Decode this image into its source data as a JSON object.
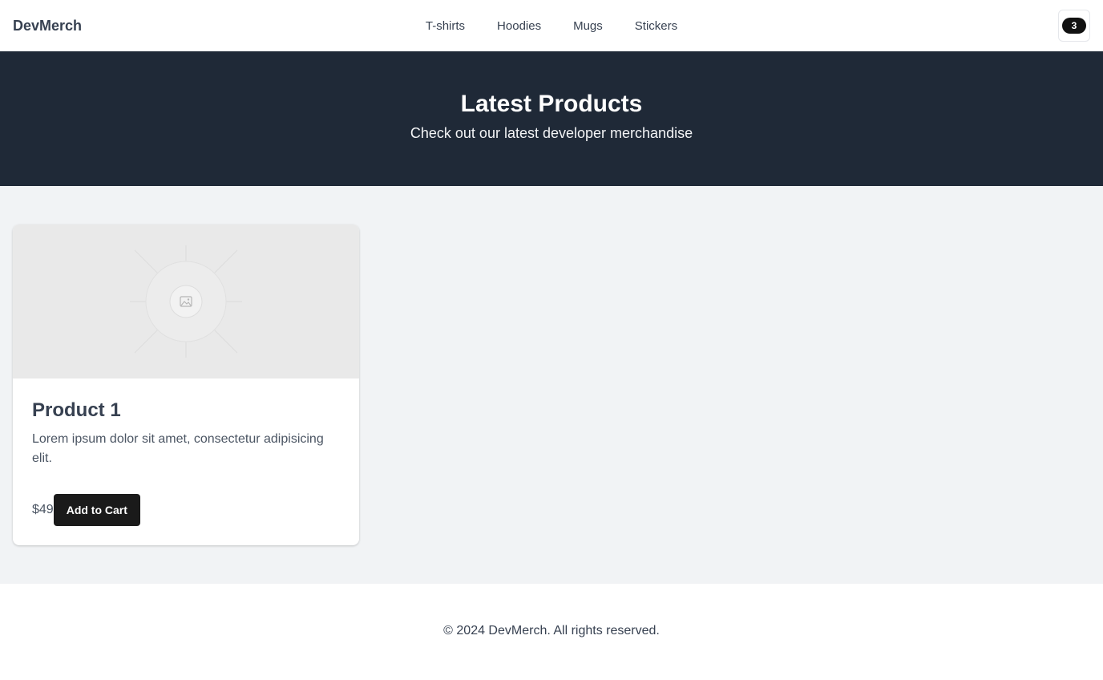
{
  "header": {
    "brand": "DevMerch",
    "nav": [
      {
        "label": "T-shirts"
      },
      {
        "label": "Hoodies"
      },
      {
        "label": "Mugs"
      },
      {
        "label": "Stickers"
      }
    ],
    "cart_count": "3"
  },
  "hero": {
    "title": "Latest Products",
    "subtitle": "Check out our latest developer merchandise"
  },
  "products": [
    {
      "image_icon": "image-placeholder-icon",
      "title": "Product 1",
      "description": "Lorem ipsum dolor sit amet, consectetur adipisicing elit.",
      "price": "$49",
      "button_label": "Add to Cart"
    }
  ],
  "footer": {
    "copyright": "© 2024 DevMerch. All rights reserved."
  },
  "colors": {
    "hero_bg": "#1f2937",
    "page_bg": "#f1f3f5",
    "button_bg": "#1a1a1a"
  }
}
